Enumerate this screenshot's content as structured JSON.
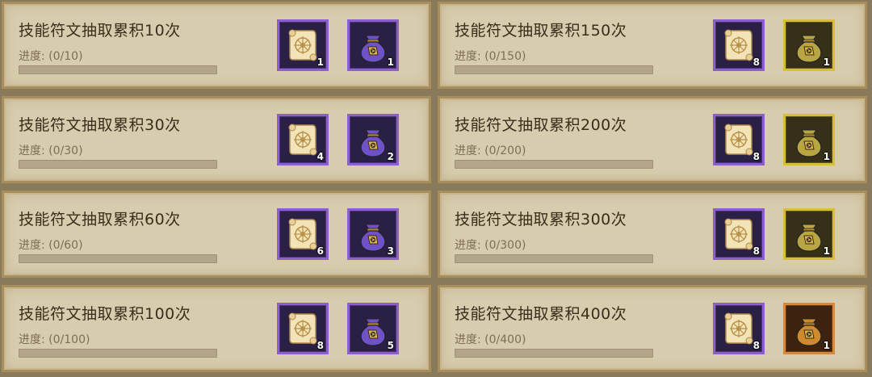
{
  "colors": {
    "panel_bg": "#d8ccae",
    "panel_border": "#a88e5a",
    "slot_purple": "#8d5fcc",
    "slot_gold": "#d8bd3a",
    "slot_orange": "#d9873a"
  },
  "tasks": [
    {
      "title": "技能符文抽取累积10次",
      "progress": "进度: (0/10)",
      "progress_fraction": 0,
      "reward1": {
        "icon": "rune-scroll-icon",
        "rarity": "purple",
        "count": "1"
      },
      "reward2": {
        "icon": "rune-bag-icon",
        "rarity": "purple",
        "count": "1"
      }
    },
    {
      "title": "技能符文抽取累积30次",
      "progress": "进度: (0/30)",
      "progress_fraction": 0,
      "reward1": {
        "icon": "rune-scroll-icon",
        "rarity": "purple",
        "count": "4"
      },
      "reward2": {
        "icon": "rune-bag-icon",
        "rarity": "purple",
        "count": "2"
      }
    },
    {
      "title": "技能符文抽取累积60次",
      "progress": "进度: (0/60)",
      "progress_fraction": 0,
      "reward1": {
        "icon": "rune-scroll-icon",
        "rarity": "purple",
        "count": "6"
      },
      "reward2": {
        "icon": "rune-bag-icon",
        "rarity": "purple",
        "count": "3"
      }
    },
    {
      "title": "技能符文抽取累积100次",
      "progress": "进度: (0/100)",
      "progress_fraction": 0,
      "reward1": {
        "icon": "rune-scroll-icon",
        "rarity": "purple",
        "count": "8"
      },
      "reward2": {
        "icon": "rune-bag-icon",
        "rarity": "purple",
        "count": "5"
      }
    },
    {
      "title": "技能符文抽取累积150次",
      "progress": "进度: (0/150)",
      "progress_fraction": 0,
      "reward1": {
        "icon": "rune-scroll-icon",
        "rarity": "purple",
        "count": "8"
      },
      "reward2": {
        "icon": "rune-bag-icon",
        "rarity": "gold",
        "count": "1"
      }
    },
    {
      "title": "技能符文抽取累积200次",
      "progress": "进度: (0/200)",
      "progress_fraction": 0,
      "reward1": {
        "icon": "rune-scroll-icon",
        "rarity": "purple",
        "count": "8"
      },
      "reward2": {
        "icon": "rune-bag-icon",
        "rarity": "gold",
        "count": "1"
      }
    },
    {
      "title": "技能符文抽取累积300次",
      "progress": "进度: (0/300)",
      "progress_fraction": 0,
      "reward1": {
        "icon": "rune-scroll-icon",
        "rarity": "purple",
        "count": "8"
      },
      "reward2": {
        "icon": "rune-bag-icon",
        "rarity": "gold",
        "count": "1"
      }
    },
    {
      "title": "技能符文抽取累积400次",
      "progress": "进度: (0/400)",
      "progress_fraction": 0,
      "reward1": {
        "icon": "rune-scroll-icon",
        "rarity": "purple",
        "count": "8"
      },
      "reward2": {
        "icon": "rune-bag-icon",
        "rarity": "orange",
        "count": "1"
      }
    }
  ]
}
